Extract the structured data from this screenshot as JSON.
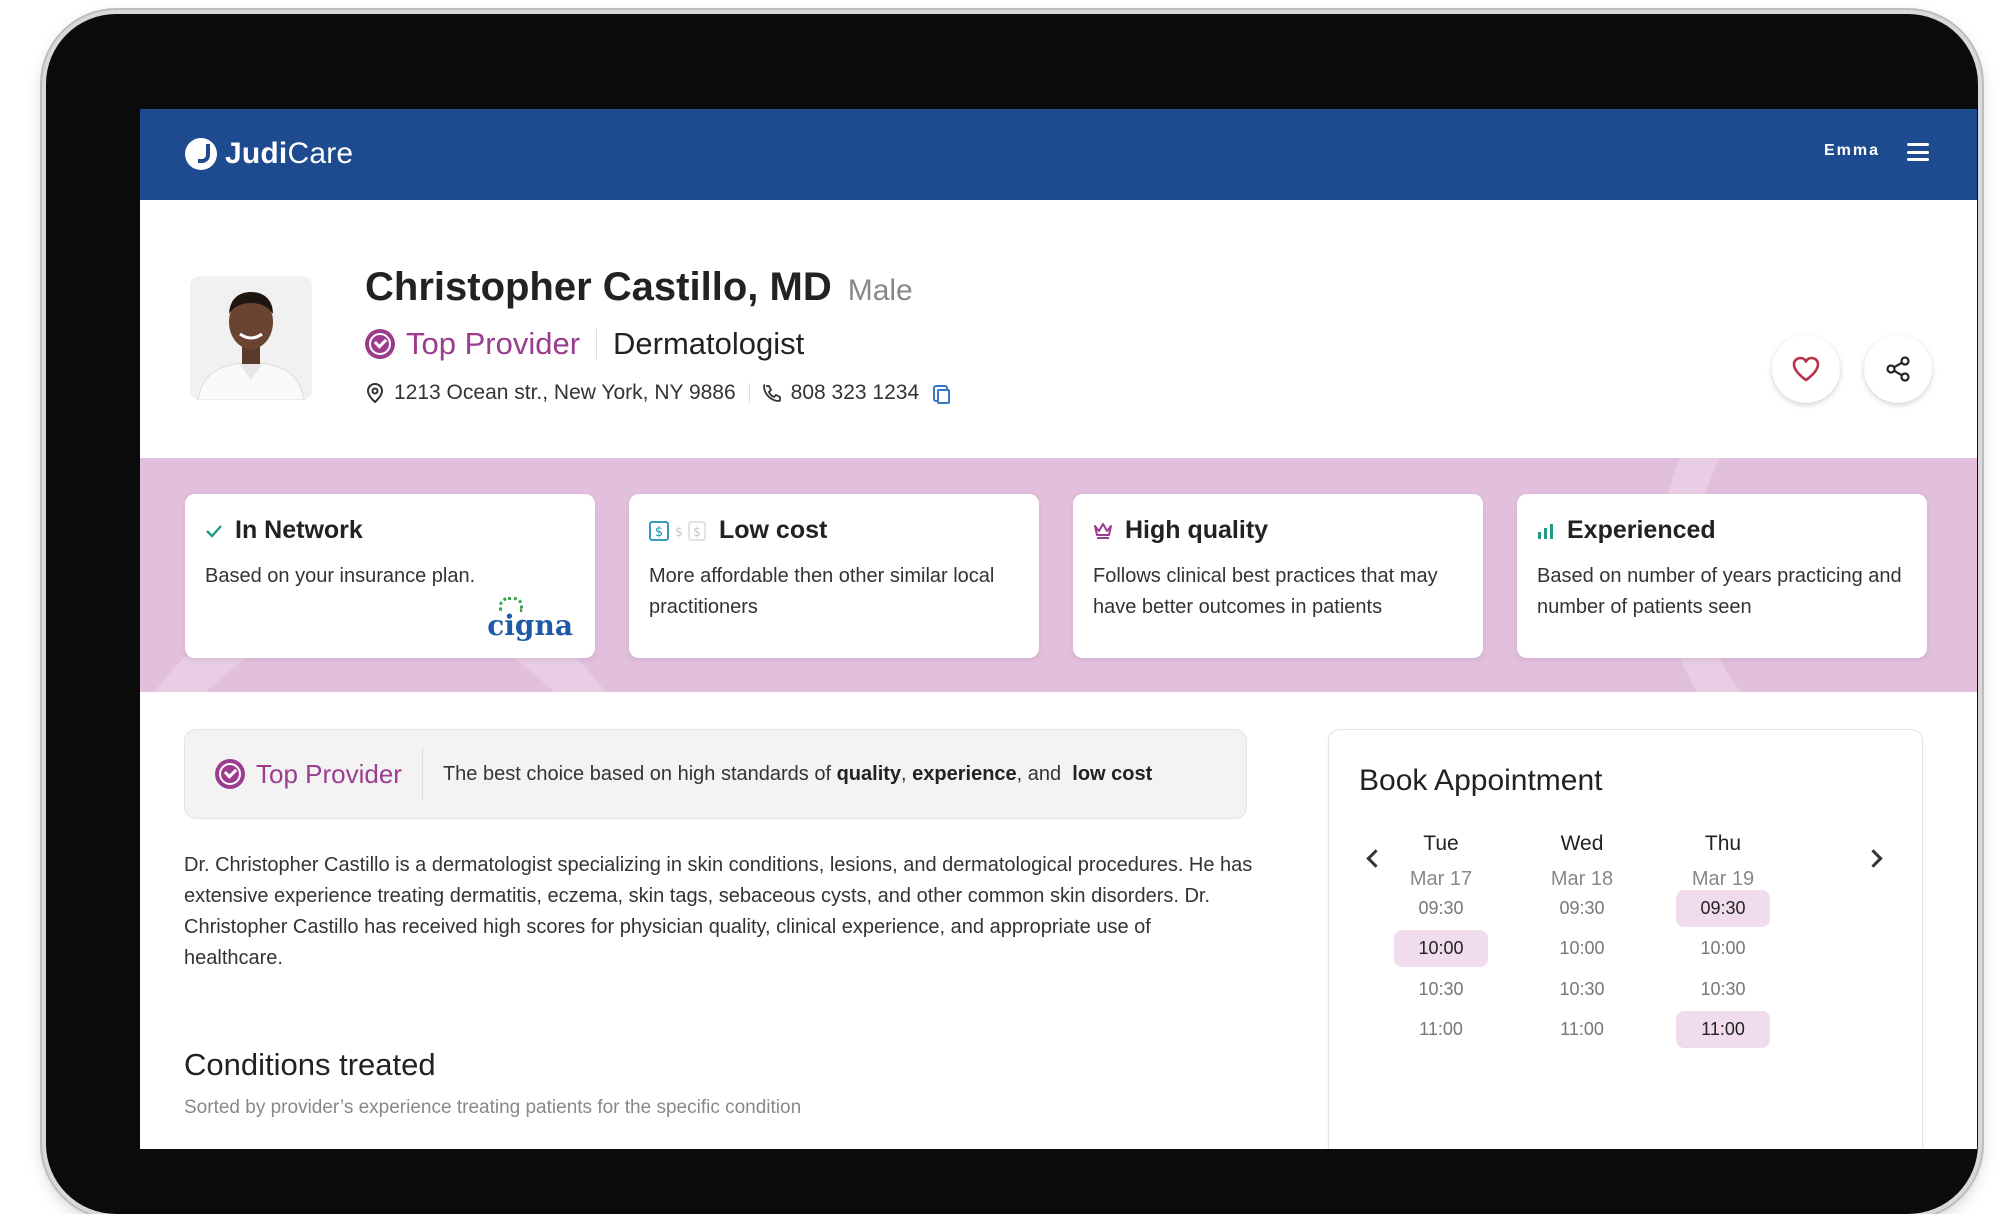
{
  "header": {
    "logo_bold": "Judi",
    "logo_light": "Care",
    "user_name": "Emma"
  },
  "profile": {
    "name": "Christopher Castillo, MD",
    "gender": "Male",
    "badge": "Top Provider",
    "specialty": "Dermatologist",
    "address": "1213 Ocean str., New York, NY 9886",
    "phone": "808 323 1234"
  },
  "features": [
    {
      "title": "In Network",
      "desc": "Based on your insurance plan.",
      "icon": "check-icon",
      "insurer": "cigna"
    },
    {
      "title": "Low cost",
      "desc": "More affordable then other similar local practitioners",
      "icon": "dollar-icon"
    },
    {
      "title": "High quality",
      "desc": "Follows clinical best practices that may have better outcomes in patients",
      "icon": "crown-icon"
    },
    {
      "title": "Experienced",
      "desc": "Based on number of years practicing and number of patients seen",
      "icon": "bar-chart-icon"
    }
  ],
  "banner": {
    "badge": "Top Provider",
    "text_prefix": "The best choice based on high standards of",
    "quality": "quality",
    "comma": ",",
    "experience": "experience",
    "and": ", and",
    "low_cost": "low cost"
  },
  "bio": "Dr. Christopher Castillo is a dermatologist specializing in skin conditions, lesions, and dermatological procedures. He has extensive experience treating dermatitis, eczema, skin tags, sebaceous cysts, and other common skin disorders. Dr. Christopher Castillo has received high scores for physician quality, clinical experience, and appropriate use of healthcare.",
  "conditions": {
    "title": "Conditions treated",
    "subtitle": "Sorted by provider’s experience treating patients for the specific condition"
  },
  "booking": {
    "title": "Book Appointment",
    "days": [
      {
        "name": "Tue",
        "date": "Mar 17",
        "slots": [
          "09:30",
          "10:00",
          "10:30",
          "11:00"
        ],
        "selected": [
          1
        ]
      },
      {
        "name": "Wed",
        "date": "Mar 18",
        "slots": [
          "09:30",
          "10:00",
          "10:30",
          "11:00"
        ],
        "selected": []
      },
      {
        "name": "Thu",
        "date": "Mar 19",
        "slots": [
          "09:30",
          "10:00",
          "10:30",
          "11:00"
        ],
        "selected": [
          0,
          3
        ]
      }
    ]
  },
  "colors": {
    "header_bg": "#1e4b8f",
    "accent": "#9c3c8e",
    "band_bg": "#e2bfdd",
    "slot_selected": "#f1dced"
  }
}
